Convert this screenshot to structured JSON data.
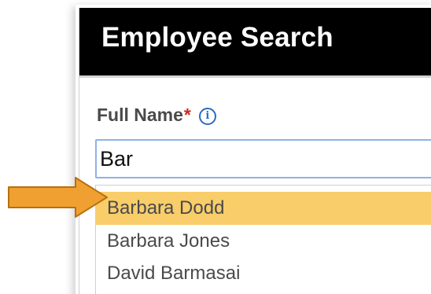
{
  "window": {
    "title": "Employee Search"
  },
  "form": {
    "full_name_label": "Full Name",
    "required_marker": "*",
    "info_icon": "info-icon",
    "info_glyph": "i",
    "search_value": "Bar"
  },
  "dropdown": {
    "options": [
      {
        "label": "Barbara Dodd",
        "highlighted": true
      },
      {
        "label": "Barbara Jones",
        "highlighted": false
      },
      {
        "label": "David Barmasai",
        "highlighted": false
      }
    ]
  },
  "annotation": {
    "arrow_icon": "arrow-right-icon",
    "arrow_color": "#f0a030",
    "arrow_outline": "#b86f10"
  },
  "colors": {
    "titlebar_bg": "#000000",
    "highlight": "#f8cd6a",
    "input_border": "#8fb2e3",
    "required_color": "#d0281c",
    "info_color": "#2a6cc4"
  }
}
